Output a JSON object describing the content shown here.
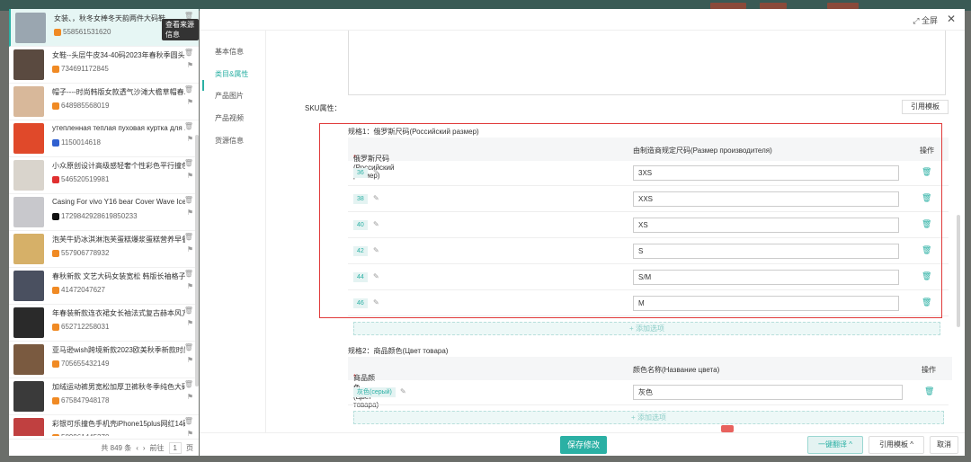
{
  "tooltip": "查看来源信息",
  "products": [
    {
      "title": "女装、，秋冬女棒冬天韵两件大码鞋",
      "id": "558561531620",
      "platform_color": "#f08a24",
      "thumb_color": "#9aa6b0",
      "active": true
    },
    {
      "title": "女鞋--头层牛皮34-40码2023年春秋季圆头...",
      "id": "734691172845",
      "platform_color": "#f08a24",
      "thumb_color": "#5a4a40"
    },
    {
      "title": "帽子----时尚韩版女款透气沙滩大檐草帽春...",
      "id": "648985568019",
      "platform_color": "#f08a24",
      "thumb_color": "#d8b89a"
    },
    {
      "title": "утепленная теплая пуховая куртка для ...",
      "id": "1150014618",
      "platform_color": "#3060d0",
      "thumb_color": "#e0492a"
    },
    {
      "title": "小众原创设计高级感轻奢个性彩色平行撞色...",
      "id": "546520519981",
      "platform_color": "#e03030",
      "thumb_color": "#d9d4cc"
    },
    {
      "title": "Casing For vivo Y16 bear Cover Wave Ice...",
      "id": "1729842928619850233",
      "platform_color": "#111111",
      "thumb_color": "#c8c8cc"
    },
    {
      "title": "泡芙牛奶冰淇淋泡芙蛋糕爆浆蛋糕营养早餐...",
      "id": "557906778932",
      "platform_color": "#f08a24",
      "thumb_color": "#d6b068"
    },
    {
      "title": "春秋新款 文艺大码女装宽松 韩版长袖格子棉...",
      "id": "41472047627",
      "platform_color": "#f08a24",
      "thumb_color": "#4a5060"
    },
    {
      "title": "年春装新款连衣裙女长袖法式复古赫本风方...",
      "id": "652712258031",
      "platform_color": "#f08a24",
      "thumb_color": "#2a2a2a"
    },
    {
      "title": "亚马逊wish跨境新款2023欧美秋季新款时尚...",
      "id": "705655432149",
      "platform_color": "#f08a24",
      "thumb_color": "#7a5a40"
    },
    {
      "title": "加绒运动裤男宽松加厚卫裤秋冬季纯色大码...",
      "id": "675847948178",
      "platform_color": "#f08a24",
      "thumb_color": "#3a3a3a"
    },
    {
      "title": "彩银可乐撞色手机壳iPhone15plus网红14磁...",
      "id": "589961445370",
      "platform_color": "#f08a24",
      "thumb_color": "#c04040"
    }
  ],
  "pager": {
    "total": "共 849 条",
    "prev": "‹",
    "next": "›",
    "goto": "前往",
    "page": "1",
    "page_unit": "页"
  },
  "header": {
    "fullscreen": "全屏",
    "close": "✕"
  },
  "nav": [
    "基本信息",
    "类目&属性",
    "产品图片",
    "产品视频",
    "货源信息"
  ],
  "sku_label": "SKU属性：",
  "cite_button": "引用模板",
  "spec1": {
    "label": "规格1：俄罗斯尺码(Российский размер)",
    "col1": "俄罗斯尺码(Российский размер)",
    "col2": "由制造商规定尺码(Размер производителя)",
    "col3": "操作",
    "rows": [
      {
        "tag": "36",
        "value": "3XS"
      },
      {
        "tag": "38",
        "value": "XXS"
      },
      {
        "tag": "40",
        "value": "XS"
      },
      {
        "tag": "42",
        "value": "S"
      },
      {
        "tag": "44",
        "value": "S/M"
      },
      {
        "tag": "46",
        "value": "M"
      }
    ],
    "add": "+ 添加选项"
  },
  "spec2": {
    "label": "规格2：商品颜色(Цвет товара)",
    "col1": "商品颜色(Цвет товара)",
    "col2": "颜色名称(Название цвета)",
    "col3": "操作",
    "rows": [
      {
        "tag": "灰色(серый)",
        "value": "灰色"
      }
    ],
    "add": "+ 添加选项"
  },
  "footer": {
    "save": "保存修改",
    "translate": "一键翻译 ^",
    "template": "引用模板 ^",
    "cancel": "取消"
  },
  "colors": {
    "accent": "#2bb0a4",
    "highlight": "#e03a3a"
  }
}
